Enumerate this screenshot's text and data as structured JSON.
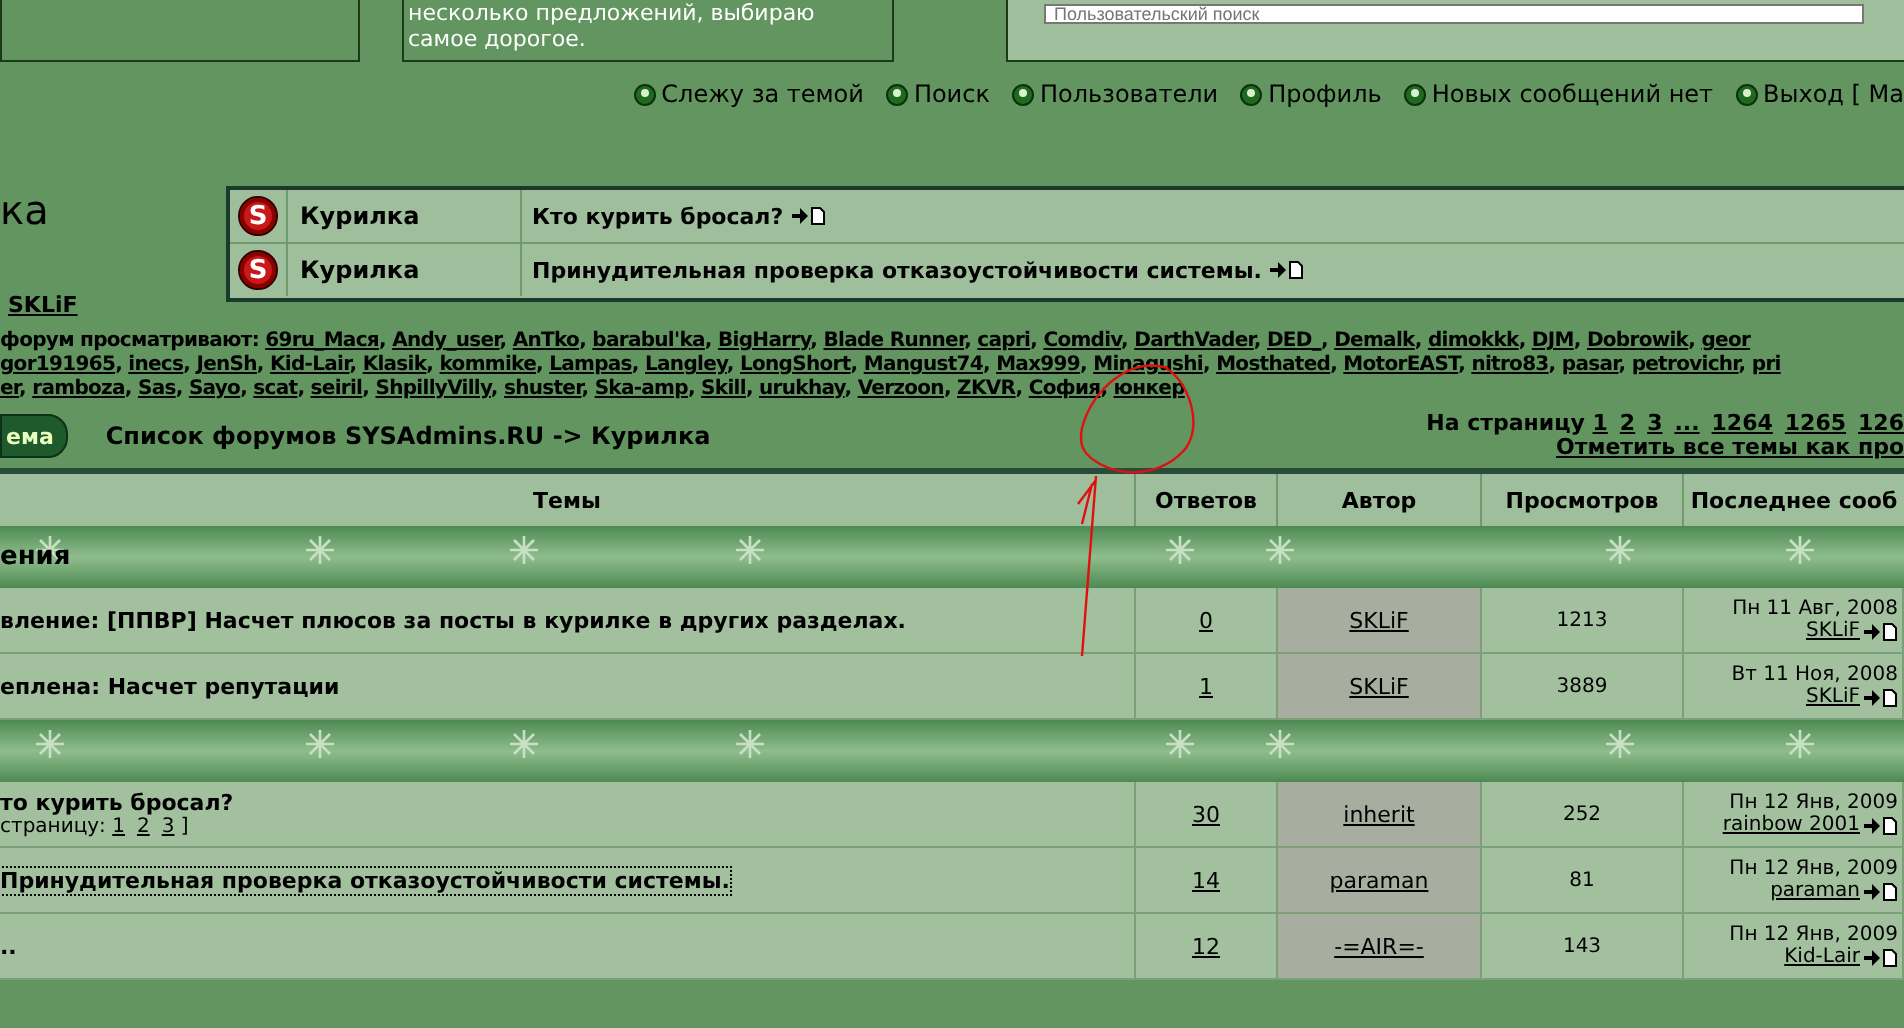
{
  "top_panels": {
    "note_lines": [
      "несколько предложений, выбираю",
      "самое дорогое."
    ],
    "search": {
      "placeholder": "Пользовательский поиск"
    }
  },
  "nav": [
    {
      "label": "Слежу за темой"
    },
    {
      "label": "Поиск"
    },
    {
      "label": "Пользователи"
    },
    {
      "label": "Профиль"
    },
    {
      "label": "Новых сообщений нет"
    },
    {
      "label": "Выход [ Ma"
    }
  ],
  "forum_title": "ка",
  "recent_topics": [
    {
      "icon_letter": "S",
      "forum": "Курилка",
      "topic": "Кто курить бросал?"
    },
    {
      "icon_letter": "S",
      "forum": "Курилка",
      "topic": "Принудительная проверка отказоустойчивости системы."
    }
  ],
  "moderator": "SKLiF",
  "viewers": {
    "label": "форум просматривают:",
    "separator": ", ",
    "lines": [
      [
        "69ru_Мася",
        "Andy_user",
        "AnTko",
        "barabul'ka",
        "BigHarry",
        "Blade Runner",
        "capri",
        "Comdiv",
        "DarthVader",
        "DED_",
        "Demalk",
        "dimokkk",
        "DJM",
        "Dobrowik",
        "geor"
      ],
      [
        "gor191965",
        "inecs",
        "JenSh",
        "Kid-Lair",
        "Klasik",
        "kommike",
        "Lampas",
        "Langley",
        "LongShort",
        "Mangust74",
        "Max999",
        "Minagushi",
        "Mosthated",
        "MotorEAST",
        "nitro83",
        "pasar",
        "petrovichr",
        "pri"
      ],
      [
        "er",
        "ramboza",
        "Sas",
        "Sayo",
        "scat",
        "seiril",
        "ShpillyVilly",
        "shuster",
        "Ska-amp",
        "Skill",
        "urukhay",
        "Verzoon",
        "ZKVR",
        "София",
        "юнкер"
      ]
    ]
  },
  "new_topic_button": "ема",
  "breadcrumb": "Список форумов SYSAdmins.RU -> Курилка",
  "pagination": {
    "label": "На страницу",
    "pages": [
      "1",
      "2",
      "3",
      "...",
      "1264",
      "1265",
      "126"
    ],
    "mark_read": "Отметить все темы как про"
  },
  "table": {
    "columns": [
      "Темы",
      "Ответов",
      "Автор",
      "Просмотров",
      "Последнее сооб"
    ],
    "sections": [
      {
        "title": "ения",
        "rows": [
          {
            "title": "вление: [ППВР] Насчет плюсов за посты в курилке в других разделах.",
            "focused": false,
            "replies": "0",
            "author": "SKLiF",
            "views": "1213",
            "last_date": "Пн 11 Авг, 2008",
            "last_author": "SKLiF"
          },
          {
            "title": "еплена: Насчет репутации",
            "focused": false,
            "replies": "1",
            "author": "SKLiF",
            "views": "3889",
            "last_date": "Вт 11 Ноя, 2008",
            "last_author": "SKLiF"
          }
        ]
      },
      {
        "rows": [
          {
            "title": "то курить бросал?",
            "focused": false,
            "pages_label": "страницу:",
            "pages": [
              "1",
              "2",
              "3"
            ],
            "pages_end": "]",
            "replies": "30",
            "author": "inherit",
            "views": "252",
            "last_date": "Пн 12 Янв, 2009",
            "last_author": "rainbow 2001"
          },
          {
            "title": "Принудительная проверка отказоустойчивости системы.",
            "focused": true,
            "replies": "14",
            "author": "paraman",
            "views": "81",
            "last_date": "Пн 12 Янв, 2009",
            "last_author": "paraman"
          },
          {
            "title": "..",
            "focused": false,
            "replies": "12",
            "author": "-=AIR=-",
            "views": "143",
            "last_date": "Пн 12 Янв, 2009",
            "last_author": "Kid-Lair"
          }
        ]
      }
    ]
  }
}
